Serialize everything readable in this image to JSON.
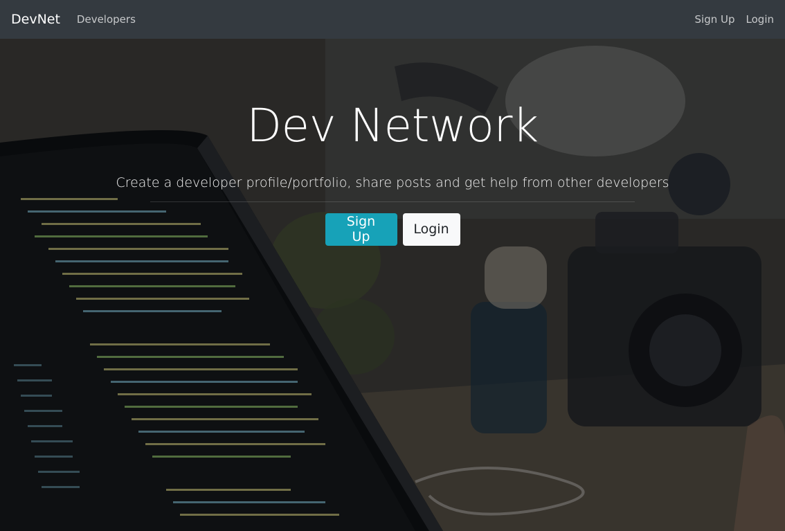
{
  "navbar": {
    "brand": "DevNet",
    "left_links": [
      {
        "label": "Developers"
      }
    ],
    "right_links": [
      {
        "label": "Sign Up"
      },
      {
        "label": "Login"
      }
    ]
  },
  "hero": {
    "title": "Dev Network",
    "lead": "Create a developer profile/portfolio, share posts and get help from other developers",
    "buttons": {
      "signup_label": "Sign Up",
      "login_label": "Login"
    }
  },
  "colors": {
    "navbar_bg": "#343a40",
    "signup_button": "#17a2b8",
    "login_button": "#f8f9fa"
  }
}
